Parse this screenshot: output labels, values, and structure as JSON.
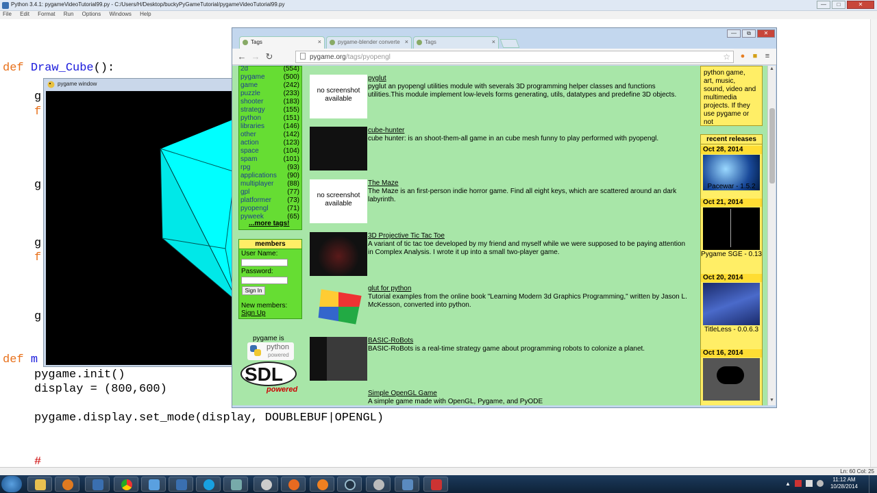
{
  "idle": {
    "title": "Python 3.4.1: pygameVideoTutorial99.py - C:/Users/H/Desktop/buckyPyGameTutorial/pygameVideoTutorial99.py",
    "menu": [
      "File",
      "Edit",
      "Format",
      "Run",
      "Options",
      "Windows",
      "Help"
    ],
    "status": "Ln: 60  Col: 25",
    "code": {
      "l1_kw": "def",
      "l1_fn": "Draw_Cube",
      "l1_rest": "():",
      "g1": "g",
      "f1": "f",
      "g2": "g",
      "g3": "g",
      "f2": "f",
      "g4": "g",
      "def2_kw": "def",
      "def2_fn": "m",
      "init": "pygame.init()",
      "display": "display = (800,600)",
      "setmode": "pygame.display.set_mode(display, DOUBLEBUF|OPENGL)",
      "comment": "#"
    }
  },
  "pygame_window": {
    "title": "pygame window",
    "cube_color": "#00ffff"
  },
  "browser": {
    "tabs": [
      {
        "label": "Tags"
      },
      {
        "label": "pygame-blender converte"
      },
      {
        "label": "Tags"
      }
    ],
    "url_host": "pygame.org",
    "url_path": "/tags/pyopengl",
    "tags": [
      {
        "name": "2d",
        "count": "(554)"
      },
      {
        "name": "pygame",
        "count": "(500)"
      },
      {
        "name": "game",
        "count": "(242)"
      },
      {
        "name": "puzzle",
        "count": "(233)"
      },
      {
        "name": "shooter",
        "count": "(183)"
      },
      {
        "name": "strategy",
        "count": "(155)"
      },
      {
        "name": "python",
        "count": "(151)"
      },
      {
        "name": "libraries",
        "count": "(146)"
      },
      {
        "name": "other",
        "count": "(142)"
      },
      {
        "name": "action",
        "count": "(123)"
      },
      {
        "name": "space",
        "count": "(104)"
      },
      {
        "name": "spam",
        "count": "(101)"
      },
      {
        "name": "rpg",
        "count": "(93)"
      },
      {
        "name": "applications",
        "count": "(90)"
      },
      {
        "name": "multiplayer",
        "count": "(88)"
      },
      {
        "name": "gpl",
        "count": "(77)"
      },
      {
        "name": "platformer",
        "count": "(73)"
      },
      {
        "name": "pyopengl",
        "count": "(71)"
      },
      {
        "name": "pyweek",
        "count": "(65)"
      }
    ],
    "more_tags": "...more tags!",
    "members": {
      "heading": "members",
      "username_label": "User Name:",
      "password_label": "Password:",
      "signin": "Sign In",
      "new_members": "New members:",
      "signup": "Sign Up"
    },
    "pygame_is": "pygame is",
    "python_powered": "python",
    "powered_sub": "powered",
    "sdl": "SDL",
    "sdl_powered": "powered",
    "items": [
      {
        "title": "pyglut",
        "noshot": "no screenshot available",
        "desc": "pyglut an pyopengl utilities module with severals 3D programming helper classes and functions utilities.This module implement low-levels forms generating, utils, datatypes and predefine 3D objects."
      },
      {
        "title": "cube-hunter",
        "desc": "cube hunter: is an shoot-them-all game in an cube mesh funny to play performed with pyopengl."
      },
      {
        "title": "The Maze",
        "noshot": "no screenshot available",
        "desc": "The Maze is an first-person indie horror game. Find all eight keys, which are scattered around an dark labyrinth."
      },
      {
        "title": "3D Projective Tic Tac Toe",
        "desc": "A variant of tic tac toe developed by my friend and myself while we were supposed to be paying attention in Complex Analysis. I wrote it up into a small two-player game."
      },
      {
        "title": "glut for python",
        "desc": "Tutorial examples from the online book \"Learning Modern 3d Graphics Programming,\" written by Jason L. McKesson, converted into python."
      },
      {
        "title": "BASIC-RoBots",
        "desc": "BASIC-RoBots is a real-time strategy game about programming robots to colonize a planet."
      },
      {
        "title": "Simple OpenGL Game",
        "desc": "A simple game made with OpenGL, Pygame, and PyODE"
      }
    ],
    "about": [
      "python game,",
      "art, music,",
      "sound, video and",
      "multimedia",
      "projects. If they",
      "use pygame or",
      "not"
    ],
    "recent_heading": "recent releases",
    "releases": [
      {
        "date": "Oct 28, 2014",
        "name": "Pacewar - 1.5.2"
      },
      {
        "date": "Oct 21, 2014",
        "name": "Pygame SGE - 0.13"
      },
      {
        "date": "Oct 20, 2014",
        "name": "TitleLess - 0.0.6.3"
      },
      {
        "date": "Oct 16, 2014",
        "name": ""
      }
    ]
  },
  "taskbar": {
    "time": "11:12 AM",
    "date": "10/28/2014"
  }
}
